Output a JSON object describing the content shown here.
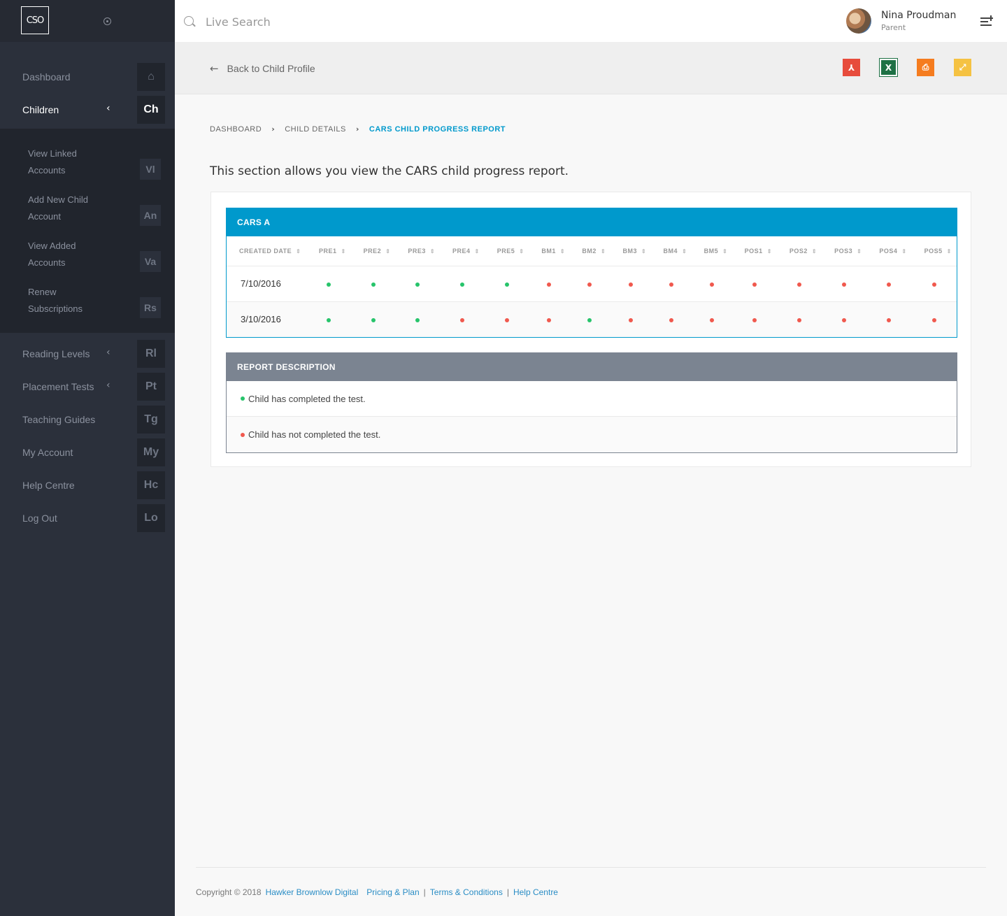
{
  "app": {
    "logo_text": "CSO"
  },
  "sidebar": {
    "nav": [
      {
        "label": "Dashboard",
        "badge": "⌂",
        "icon": "home-icon"
      },
      {
        "label": "Children",
        "badge": "Ch",
        "chevron": "‹",
        "active": true
      }
    ],
    "children_sub": [
      {
        "label": "View Linked Accounts",
        "badge": "Vl"
      },
      {
        "label": "Add New Child Account",
        "badge": "An"
      },
      {
        "label": "View Added Accounts",
        "badge": "Va"
      },
      {
        "label": "Renew Subscriptions",
        "badge": "Rs"
      }
    ],
    "nav2": [
      {
        "label": "Reading Levels",
        "badge": "Rl",
        "chevron": "‹"
      },
      {
        "label": "Placement Tests",
        "badge": "Pt",
        "chevron": "‹"
      },
      {
        "label": "Teaching Guides",
        "badge": "Tg"
      },
      {
        "label": "My Account",
        "badge": "My"
      },
      {
        "label": "Help Centre",
        "badge": "Hc"
      },
      {
        "label": "Log Out",
        "badge": "Lo"
      }
    ]
  },
  "header": {
    "search_placeholder": "Live Search",
    "user_name": "Nina Proudman",
    "user_role": "Parent"
  },
  "actionbar": {
    "back_label": "Back to Child Profile",
    "buttons": [
      {
        "name": "pdf-export-button",
        "icon": "pdf-icon",
        "glyph": "⅄",
        "color": "#e74c3c"
      },
      {
        "name": "excel-export-button",
        "icon": "excel-icon",
        "glyph": "X",
        "color": "#1e7145"
      },
      {
        "name": "print-button",
        "icon": "print-icon",
        "glyph": "⎙",
        "color": "#f57c1f"
      },
      {
        "name": "expand-button",
        "icon": "expand-icon",
        "glyph": "⤢",
        "color": "#f5c242"
      }
    ]
  },
  "breadcrumb": {
    "items": [
      "DASHBOARD",
      "CHILD DETAILS"
    ],
    "active": "CARS CHILD PROGRESS REPORT"
  },
  "intro": "This section allows you view the CARS child progress report.",
  "cars_table": {
    "title": "CARS A",
    "columns": [
      "CREATED DATE",
      "PRE1",
      "PRE2",
      "PRE3",
      "PRE4",
      "PRE5",
      "BM1",
      "BM2",
      "BM3",
      "BM4",
      "BM5",
      "POS1",
      "POS2",
      "POS3",
      "POS4",
      "POS5"
    ],
    "rows": [
      {
        "date": "7/10/2016",
        "status": [
          "g",
          "g",
          "g",
          "g",
          "g",
          "r",
          "r",
          "r",
          "r",
          "r",
          "r",
          "r",
          "r",
          "r",
          "r"
        ]
      },
      {
        "date": "3/10/2016",
        "status": [
          "g",
          "g",
          "g",
          "r",
          "r",
          "r",
          "g",
          "r",
          "r",
          "r",
          "r",
          "r",
          "r",
          "r",
          "r"
        ]
      }
    ]
  },
  "report_description": {
    "title": "REPORT DESCRIPTION",
    "completed": "Child has completed the test.",
    "not_completed": "Child has not completed the test."
  },
  "colors": {
    "completed": "#27c46b",
    "not_completed": "#f0594e",
    "accent": "#0099cc"
  },
  "footer": {
    "copyright": "Copyright © 2018",
    "company": "Hawker Brownlow Digital",
    "links": [
      "Pricing & Plan",
      "Terms & Conditions",
      "Help Centre"
    ]
  }
}
